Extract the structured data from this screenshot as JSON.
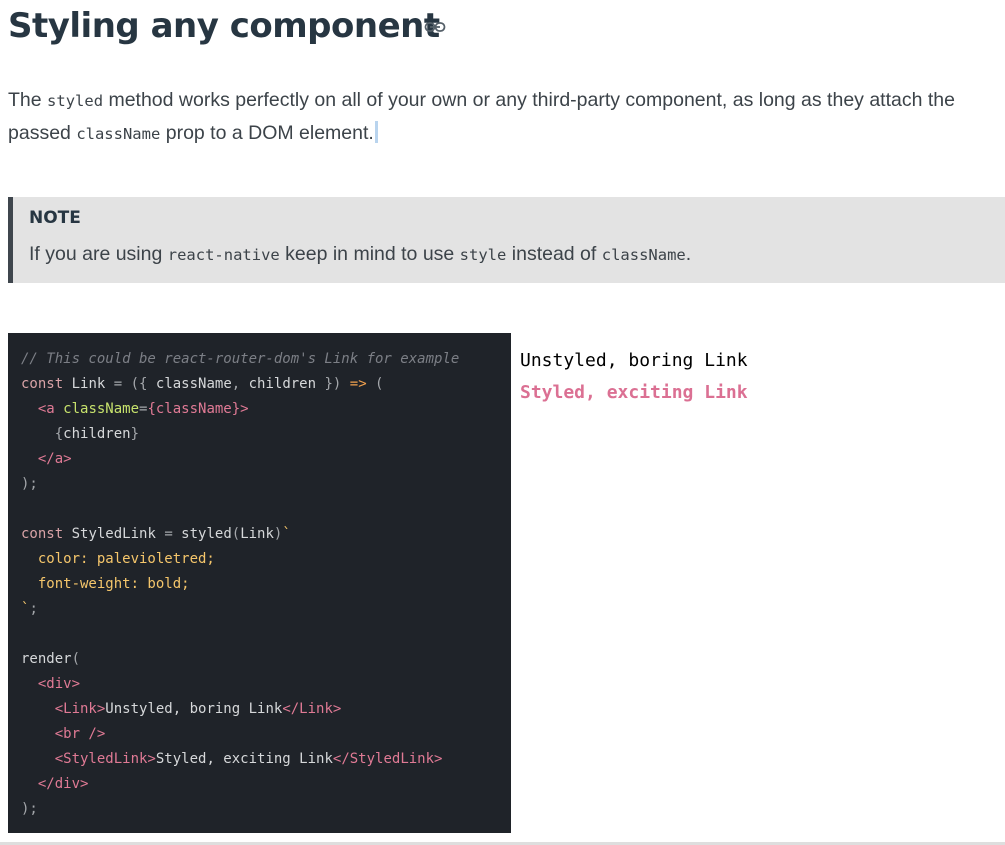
{
  "heading": {
    "title": "Styling any component",
    "anchor_icon": "link-icon"
  },
  "intro": {
    "t1": "The ",
    "c1": "styled",
    "t2": " method works perfectly on all of your own or any third-party component, as long as they attach the passed ",
    "c2": "className",
    "t3": " prop to a DOM element."
  },
  "note": {
    "title": "NOTE",
    "t1": "If you are using ",
    "c1": "react-native",
    "t2": " keep in mind to use ",
    "c2": "style",
    "t3": " instead of ",
    "c3": "className",
    "t4": "."
  },
  "code": {
    "lines": [
      [
        {
          "t": "// This could be react-router-dom's Link for example",
          "c": "comment"
        }
      ],
      [
        {
          "t": "const",
          "c": "kw"
        },
        {
          "t": " Link ",
          "c": "plain"
        },
        {
          "t": "=",
          "c": "punct"
        },
        {
          "t": " ({ ",
          "c": "punct"
        },
        {
          "t": "className",
          "c": "plain"
        },
        {
          "t": ", ",
          "c": "punct"
        },
        {
          "t": "children",
          "c": "plain"
        },
        {
          "t": " }) ",
          "c": "punct"
        },
        {
          "t": "=>",
          "c": "op"
        },
        {
          "t": " (",
          "c": "punct"
        }
      ],
      [
        {
          "t": "  ",
          "c": "plain"
        },
        {
          "t": "<a ",
          "c": "tag"
        },
        {
          "t": "className",
          "c": "attr"
        },
        {
          "t": "=",
          "c": "punct"
        },
        {
          "t": "{className}",
          "c": "tag"
        },
        {
          "t": ">",
          "c": "tag"
        }
      ],
      [
        {
          "t": "    ",
          "c": "plain"
        },
        {
          "t": "{",
          "c": "punct"
        },
        {
          "t": "children",
          "c": "plain"
        },
        {
          "t": "}",
          "c": "punct"
        }
      ],
      [
        {
          "t": "  ",
          "c": "plain"
        },
        {
          "t": "</a>",
          "c": "tag"
        }
      ],
      [
        {
          "t": ");",
          "c": "punct"
        }
      ],
      [],
      [
        {
          "t": "const",
          "c": "kw"
        },
        {
          "t": " StyledLink ",
          "c": "plain"
        },
        {
          "t": "=",
          "c": "punct"
        },
        {
          "t": " styled",
          "c": "plain"
        },
        {
          "t": "(",
          "c": "punct"
        },
        {
          "t": "Link",
          "c": "plain"
        },
        {
          "t": ")",
          "c": "punct"
        },
        {
          "t": "`",
          "c": "prop"
        }
      ],
      [
        {
          "t": "  color: palevioletred;",
          "c": "prop"
        }
      ],
      [
        {
          "t": "  font-weight: bold;",
          "c": "prop"
        }
      ],
      [
        {
          "t": "`",
          "c": "prop"
        },
        {
          "t": ";",
          "c": "punct"
        }
      ],
      [],
      [
        {
          "t": "render",
          "c": "plain"
        },
        {
          "t": "(",
          "c": "punct"
        }
      ],
      [
        {
          "t": "  ",
          "c": "plain"
        },
        {
          "t": "<div>",
          "c": "tag"
        }
      ],
      [
        {
          "t": "    ",
          "c": "plain"
        },
        {
          "t": "<Link>",
          "c": "tag"
        },
        {
          "t": "Unstyled, boring Link",
          "c": "plain"
        },
        {
          "t": "</Link>",
          "c": "tag"
        }
      ],
      [
        {
          "t": "    ",
          "c": "plain"
        },
        {
          "t": "<br />",
          "c": "tag"
        }
      ],
      [
        {
          "t": "    ",
          "c": "plain"
        },
        {
          "t": "<StyledLink>",
          "c": "tag"
        },
        {
          "t": "Styled, exciting Link",
          "c": "plain"
        },
        {
          "t": "</StyledLink>",
          "c": "tag"
        }
      ],
      [
        {
          "t": "  ",
          "c": "plain"
        },
        {
          "t": "</div>",
          "c": "tag"
        }
      ],
      [
        {
          "t": ");",
          "c": "punct"
        }
      ]
    ]
  },
  "preview": {
    "unstyled": "Unstyled, boring Link",
    "styled": "Styled, exciting Link",
    "styled_color": "#db7093"
  },
  "colors": {
    "code_bg": "#1f2329",
    "note_bg": "#e3e3e3",
    "heading": "#273642"
  }
}
